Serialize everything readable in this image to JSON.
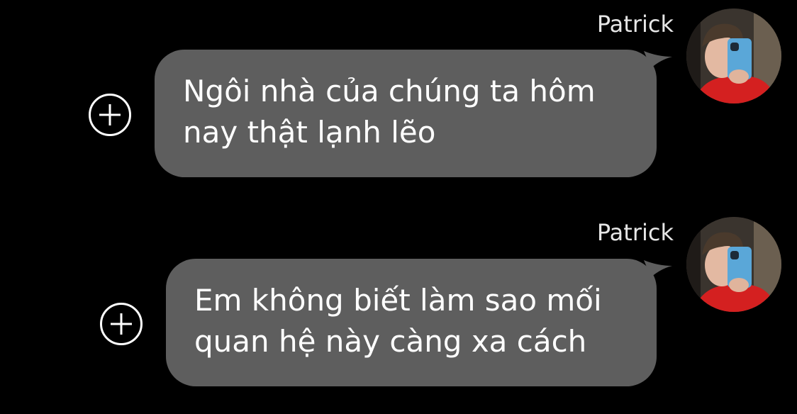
{
  "messages": [
    {
      "sender": "Patrick",
      "lines": [
        "Ngôi nhà của chúng ta hôm",
        "nay thật lạnh lẽo"
      ],
      "avatar_icon": "user-photo-avatar",
      "action_icon": "add-reaction-plus-icon"
    },
    {
      "sender": "Patrick",
      "lines": [
        "Em không biết làm sao mối",
        "quan hệ này càng xa cách"
      ],
      "avatar_icon": "user-photo-avatar",
      "action_icon": "add-reaction-plus-icon"
    }
  ],
  "colors": {
    "background": "#000000",
    "bubble": "#5e5e5e",
    "text": "#ffffff",
    "sender_text": "#e6e6e6"
  }
}
